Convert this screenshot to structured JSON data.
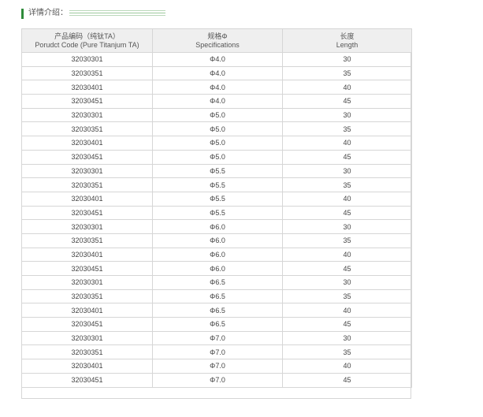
{
  "section": {
    "title": "详情介绍："
  },
  "table": {
    "headers": [
      {
        "line1": "产品编码（纯钛TA）",
        "line2": "Porudct Code (Pure Titanjum TA)"
      },
      {
        "line1": "规格Φ",
        "line2": "Specifications"
      },
      {
        "line1": "长度",
        "line2": "Length"
      }
    ],
    "rows": [
      [
        "32030301",
        "Φ4.0",
        "30"
      ],
      [
        "32030351",
        "Φ4.0",
        "35"
      ],
      [
        "32030401",
        "Φ4.0",
        "40"
      ],
      [
        "32030451",
        "Φ4.0",
        "45"
      ],
      [
        "32030301",
        "Φ5.0",
        "30"
      ],
      [
        "32030351",
        "Φ5.0",
        "35"
      ],
      [
        "32030401",
        "Φ5.0",
        "40"
      ],
      [
        "32030451",
        "Φ5.0",
        "45"
      ],
      [
        "32030301",
        "Φ5.5",
        "30"
      ],
      [
        "32030351",
        "Φ5.5",
        "35"
      ],
      [
        "32030401",
        "Φ5.5",
        "40"
      ],
      [
        "32030451",
        "Φ5.5",
        "45"
      ],
      [
        "32030301",
        "Φ6.0",
        "30"
      ],
      [
        "32030351",
        "Φ6.0",
        "35"
      ],
      [
        "32030401",
        "Φ6.0",
        "40"
      ],
      [
        "32030451",
        "Φ6.0",
        "45"
      ],
      [
        "32030301",
        "Φ6.5",
        "30"
      ],
      [
        "32030351",
        "Φ6.5",
        "35"
      ],
      [
        "32030401",
        "Φ6.5",
        "40"
      ],
      [
        "32030451",
        "Φ6.5",
        "45"
      ],
      [
        "32030301",
        "Φ7.0",
        "30"
      ],
      [
        "32030351",
        "Φ7.0",
        "35"
      ],
      [
        "32030401",
        "Φ7.0",
        "40"
      ],
      [
        "32030451",
        "Φ7.0",
        "45"
      ]
    ]
  },
  "colors": {
    "accent": "#2e8b3a",
    "header_bg": "#efefef",
    "border": "#d6d6d6"
  }
}
